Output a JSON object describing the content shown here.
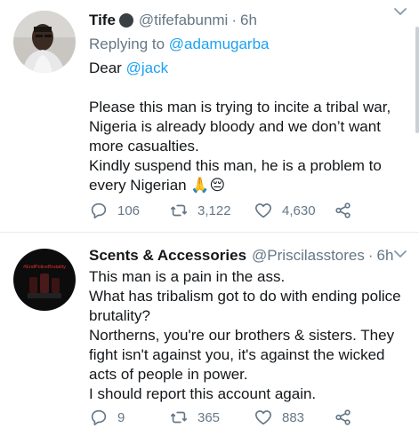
{
  "tweets": [
    {
      "name": "Tife",
      "handle": "@tifefabunmi",
      "dot": "·",
      "time": "6h",
      "reply_prefix": "Replying to ",
      "reply_to": "@adamugarba",
      "mention": "@jack",
      "line_dear": "Dear ",
      "para1": "Please this man is trying to incite a tribal war, Nigeria is already bloody and we don’t want more casualties.",
      "para2": "Kindly suspend this man, he is a problem to every Nigerian 🙏😔",
      "replies": "106",
      "retweets": "3,122",
      "likes": "4,630",
      "avatar_icon": "person-photo",
      "caret_icon": "chevron-down-icon"
    },
    {
      "name": "Scents & Accessories",
      "handle": "@Priscilasstores",
      "dot": "·",
      "time": "6h",
      "line1": "This man is a pain in the ass.",
      "line2": "What has tribalism got to do with ending police brutality?",
      "line3": "Northerns, you're our brothers & sisters. They fight isn't against you, it's against the wicked acts of people in power.",
      "line4": "I should report this account again.",
      "replies": "9",
      "retweets": "365",
      "likes": "883",
      "avatar_text": "#EndPoliceBrutality",
      "caret_icon": "chevron-down-icon"
    }
  ],
  "colors": {
    "text": "#14171a",
    "secondary": "#657786",
    "link": "#1da1f2",
    "divider": "#e6ecf0"
  }
}
